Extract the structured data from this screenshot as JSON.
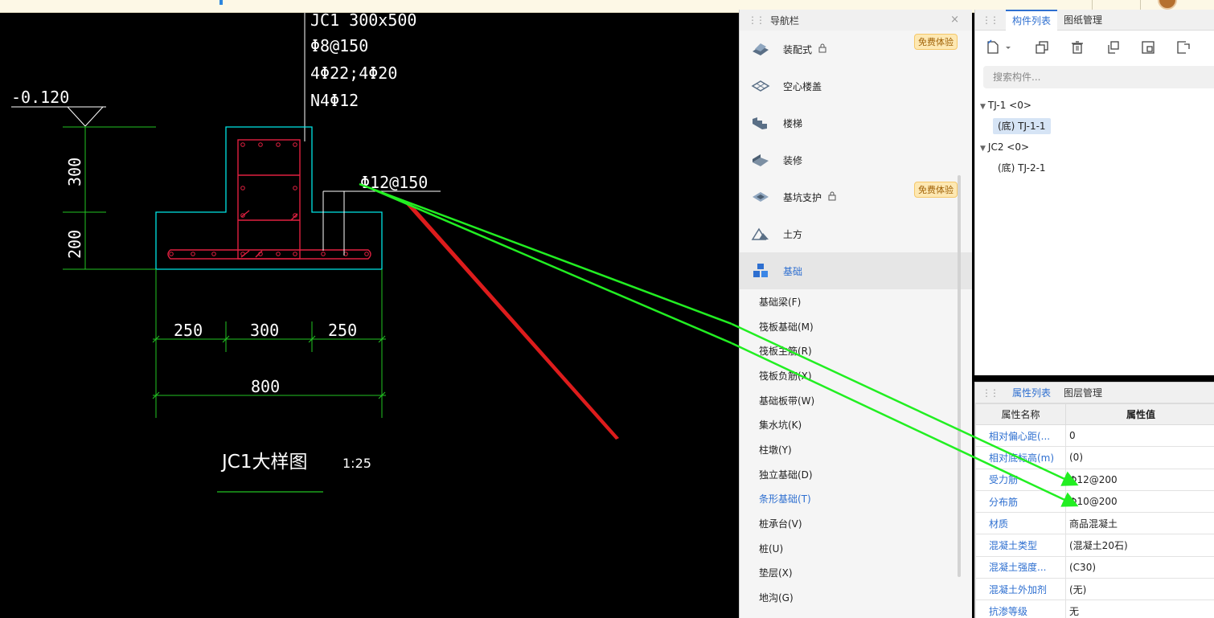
{
  "cad": {
    "title_line1": "JC1 300x500",
    "title_line2": "Φ8@150",
    "title_line3": "4Φ22;4Φ20",
    "title_line4": "N4Φ12",
    "elevation": "-0.120",
    "dim_300_vertical": "300",
    "dim_200_vertical": "200",
    "rebar_label": "Φ12@150",
    "dim_250_left": "250",
    "dim_300_mid": "300",
    "dim_250_right": "250",
    "dim_800": "800",
    "detail_title": "JC1大样图",
    "scale": "1:25",
    "colors": {
      "section_outline": "#00e5e5",
      "rebar": "#e02040",
      "dimension": "#22c322",
      "text": "#ffffff",
      "arrow_green": "#22ee22",
      "arrow_red": "#ee2222"
    }
  },
  "nav": {
    "header": "导航栏",
    "close_glyph": "×",
    "categories": [
      {
        "label": "装配式",
        "icon": "prefab-icon",
        "locked": true,
        "badge": "免费体验"
      },
      {
        "label": "空心楼盖",
        "icon": "hollow-slab-icon",
        "locked": false,
        "badge": ""
      },
      {
        "label": "楼梯",
        "icon": "stairs-icon",
        "locked": false,
        "badge": ""
      },
      {
        "label": "装修",
        "icon": "decoration-icon",
        "locked": false,
        "badge": ""
      },
      {
        "label": "基坑支护",
        "icon": "excavation-support-icon",
        "locked": true,
        "badge": "免费体验"
      },
      {
        "label": "土方",
        "icon": "earthwork-icon",
        "locked": false,
        "badge": ""
      },
      {
        "label": "基础",
        "icon": "foundation-icon",
        "locked": false,
        "badge": "",
        "active": true
      }
    ],
    "lock_glyph": "🔒",
    "subitems": [
      {
        "label": "基础梁(F)"
      },
      {
        "label": "筏板基础(M)"
      },
      {
        "label": "筏板主筋(R)"
      },
      {
        "label": "筏板负筋(X)"
      },
      {
        "label": "基础板带(W)"
      },
      {
        "label": "集水坑(K)"
      },
      {
        "label": "柱墩(Y)"
      },
      {
        "label": "独立基础(D)"
      },
      {
        "label": "条形基础(T)",
        "active": true
      },
      {
        "label": "桩承台(V)"
      },
      {
        "label": "桩(U)"
      },
      {
        "label": "垫层(X)"
      },
      {
        "label": "地沟(G)"
      }
    ]
  },
  "components": {
    "tabs": [
      "构件列表",
      "图纸管理"
    ],
    "search_placeholder": "搜索构件...",
    "tree": [
      {
        "group": "TJ-1 <0>",
        "children": [
          {
            "label": "(底) TJ-1-1",
            "selected": true
          }
        ]
      },
      {
        "group": "JC2 <0>",
        "children": [
          {
            "label": "(底) TJ-2-1",
            "selected": false
          }
        ]
      }
    ]
  },
  "properties": {
    "tabs": [
      "属性列表",
      "图层管理"
    ],
    "col_name": "属性名称",
    "col_value": "属性值",
    "rows": [
      {
        "name": "相对偏心距(...",
        "value": "0"
      },
      {
        "name": "相对底标高(m)",
        "value": "(0)"
      },
      {
        "name": "受力筋",
        "value": "Φ12@200"
      },
      {
        "name": "分布筋",
        "value": "Φ10@200"
      },
      {
        "name": "材质",
        "value": "商品混凝土"
      },
      {
        "name": "混凝土类型",
        "value": "(混凝土20石)"
      },
      {
        "name": "混凝土强度...",
        "value": "(C30)"
      },
      {
        "name": "混凝土外加剂",
        "value": "(无)"
      },
      {
        "name": "抗渗等级",
        "value": "无"
      }
    ]
  }
}
